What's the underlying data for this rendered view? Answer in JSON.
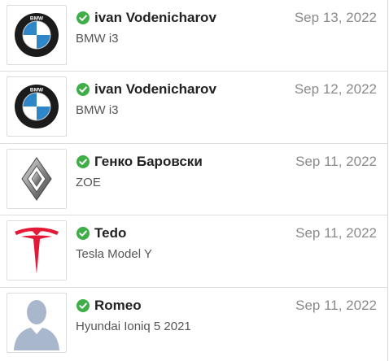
{
  "colors": {
    "verified": "#3fae49",
    "date_text": "#8a8a8a",
    "name_text": "#222222",
    "car_text": "#555555",
    "divider": "#dedede"
  },
  "reviews": [
    {
      "user": "ivan Vodenicharov",
      "date": "Sep 13, 2022",
      "car": "BMW i3",
      "logo": "bmw-logo",
      "verified_icon": "check-circle-icon"
    },
    {
      "user": "ivan Vodenicharov",
      "date": "Sep 12, 2022",
      "car": "BMW i3",
      "logo": "bmw-logo",
      "verified_icon": "check-circle-icon"
    },
    {
      "user": "Генко Баровски",
      "date": "Sep 11, 2022",
      "car": "ZOE",
      "logo": "renault-logo",
      "verified_icon": "check-circle-icon"
    },
    {
      "user": "Tedo",
      "date": "Sep 11, 2022",
      "car": "Tesla Model Y",
      "logo": "tesla-logo",
      "verified_icon": "check-circle-icon"
    },
    {
      "user": "Romeo",
      "date": "Sep 11, 2022",
      "car": "Hyundai Ioniq 5 2021",
      "logo": "default-avatar",
      "verified_icon": "check-circle-icon"
    }
  ]
}
